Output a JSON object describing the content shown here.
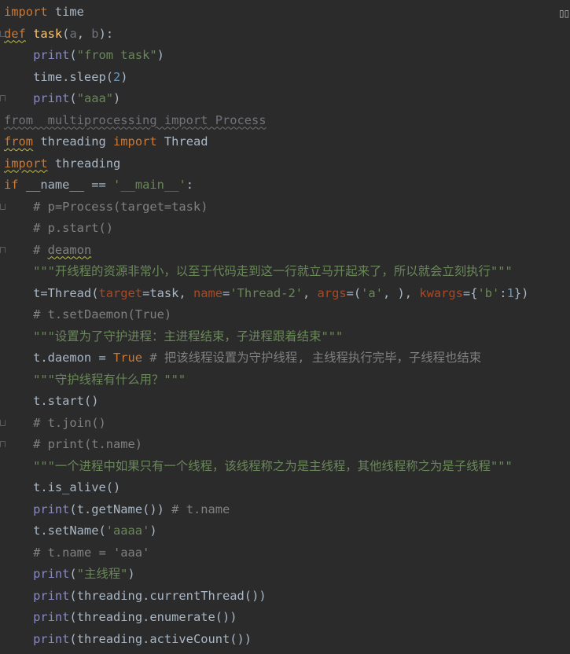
{
  "editor": {
    "language": "python",
    "status_icon": "reader-mode-icon",
    "lines": [
      "import time",
      "def task(a, b):",
      "    print(\"from task\")",
      "    time.sleep(2)",
      "    print(\"aaa\")",
      "from  multiprocessing import Process",
      "from threading import Thread",
      "import threading",
      "if __name__ == '__main__':",
      "    # p=Process(target=task)",
      "    # p.start()",
      "    # deamon",
      "    \"\"\"开线程的资源非常小，以至于代码走到这一行就立马开起来了，所以就会立刻执行\"\"\"",
      "    t=Thread(target=task, name='Thread-2', args=('a', ), kwargs={'b':1})",
      "    # t.setDaemon(True)",
      "    \"\"\"设置为了守护进程：主进程结束，子进程跟着结束\"\"\"",
      "    t.daemon = True # 把该线程设置为守护线程, 主线程执行完毕，子线程也结束",
      "    \"\"\"守护线程有什么用？\"\"\"",
      "    t.start()",
      "    # t.join()",
      "    # print(t.name)",
      "    \"\"\"一个进程中如果只有一个线程，该线程称之为是主线程，其他线程称之为是子线程\"\"\"",
      "    t.is_alive()",
      "    print(t.getName()) # t.name",
      "    t.setName('aaaa')",
      "    # t.name = 'aaa'",
      "    print(\"主线程\")",
      "    print(threading.currentThread())",
      "    print(threading.enumerate())",
      "    print(threading.activeCount())"
    ]
  }
}
